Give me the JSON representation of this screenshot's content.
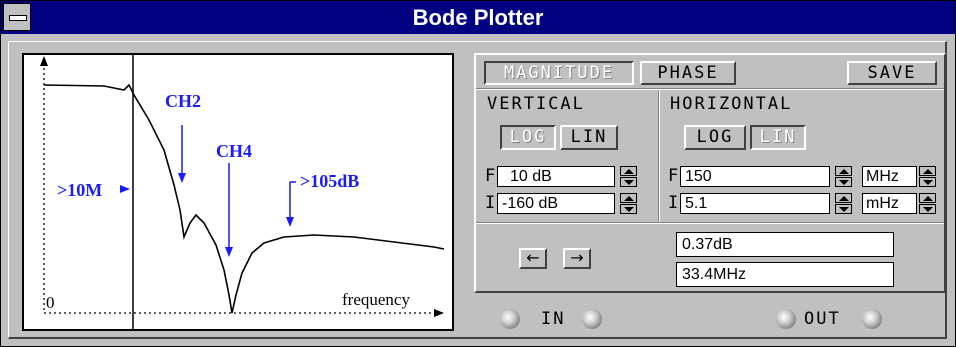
{
  "window": {
    "title": "Bode Plotter"
  },
  "plot": {
    "origin_label": "0",
    "xaxis_label": "frequency",
    "annotations": {
      "m10": ">10M",
      "ch2": "CH2",
      "ch4": "CH4",
      "db105": ">105dB"
    },
    "annotation_color": "#1a1aff"
  },
  "mode": {
    "magnitude_label": "MAGNITUDE",
    "phase_label": "PHASE",
    "save_label": "SAVE"
  },
  "vertical": {
    "title": "VERTICAL",
    "log_label": "LOG",
    "lin_label": "LIN",
    "final_prefix": "F",
    "initial_prefix": "I",
    "final_value": "10 dB",
    "initial_value": "-160 dB"
  },
  "horizontal": {
    "title": "HORIZONTAL",
    "log_label": "LOG",
    "lin_label": "LIN",
    "final_prefix": "F",
    "initial_prefix": "I",
    "final_value": "150",
    "initial_value": "5.1",
    "final_unit": "MHz",
    "initial_unit": "mHz"
  },
  "readout": {
    "left_arrow": "←",
    "right_arrow": "→",
    "value_db": "0.37dB",
    "value_freq": "33.4MHz"
  },
  "terminals": {
    "in_label": "IN",
    "out_label": "OUT"
  },
  "colors": {
    "title_bar": "#000080",
    "face": "#c0c0c0"
  }
}
